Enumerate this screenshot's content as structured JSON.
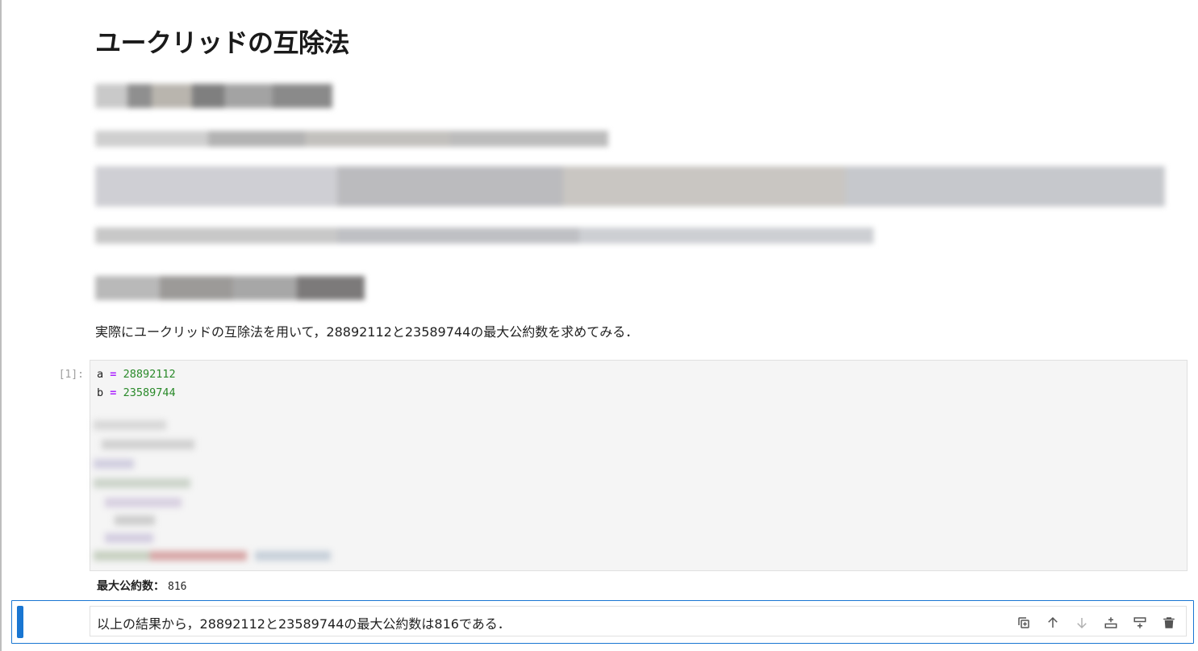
{
  "notebook": {
    "title": "ユークリッドの互除法",
    "intro_text": "実際にユークリッドの互除法を用いて，28892112と23589744の最大公約数を求めてみる．",
    "code_cell": {
      "prompt": "[1]:",
      "line1": {
        "var": "a",
        "op": "=",
        "value": "28892112"
      },
      "line2": {
        "var": "b",
        "op": "=",
        "value": "23589744"
      }
    },
    "output": {
      "label": "最大公約数：",
      "value": "816"
    },
    "active_cell": {
      "text": "以上の結果から，28892112と23589744の最大公約数は816である．",
      "toolbar": [
        "duplicate-icon",
        "move-up-icon",
        "move-down-icon",
        "insert-above-icon",
        "insert-below-icon",
        "delete-icon"
      ]
    }
  },
  "colors": {
    "accent": "#1976d2",
    "code_bg": "#f5f5f5",
    "number": "#2a8a2a",
    "operator": "#aa22ff"
  }
}
